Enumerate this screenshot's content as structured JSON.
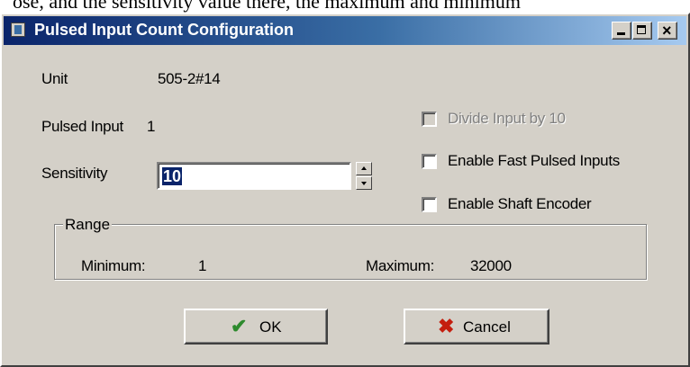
{
  "top_strip_text": "ose, and the sensitivity value there, the maximum and minimum",
  "window": {
    "title": "Pulsed Input Count Configuration",
    "controls": [
      "minimize",
      "maximize",
      "close"
    ]
  },
  "fields": {
    "unit_label": "Unit",
    "unit_value": "505-2#14",
    "pulsed_input_label": "Pulsed Input",
    "pulsed_input_value": "1",
    "sensitivity_label": "Sensitivity",
    "sensitivity_value": "10"
  },
  "options": {
    "divide_input": {
      "label": "Divide Input by 10",
      "checked": false,
      "enabled": false
    },
    "fast_pulsed": {
      "label": "Enable Fast Pulsed Inputs",
      "checked": false,
      "enabled": true
    },
    "shaft_encoder": {
      "label": "Enable Shaft Encoder",
      "checked": false,
      "enabled": true
    }
  },
  "range": {
    "group_label": "Range",
    "minimum_label": "Minimum:",
    "minimum_value": "1",
    "maximum_label": "Maximum:",
    "maximum_value": "32000"
  },
  "buttons": {
    "ok_label": "OK",
    "cancel_label": "Cancel"
  },
  "icons": {
    "ok": "checkmark-icon",
    "cancel": "x-icon"
  },
  "colors": {
    "titlebar_start": "#0a246a",
    "titlebar_end": "#a6caf0",
    "dialog_face": "#d4d0c8",
    "ok_icon": "#2d8a2d",
    "cancel_icon": "#c41e0e"
  }
}
